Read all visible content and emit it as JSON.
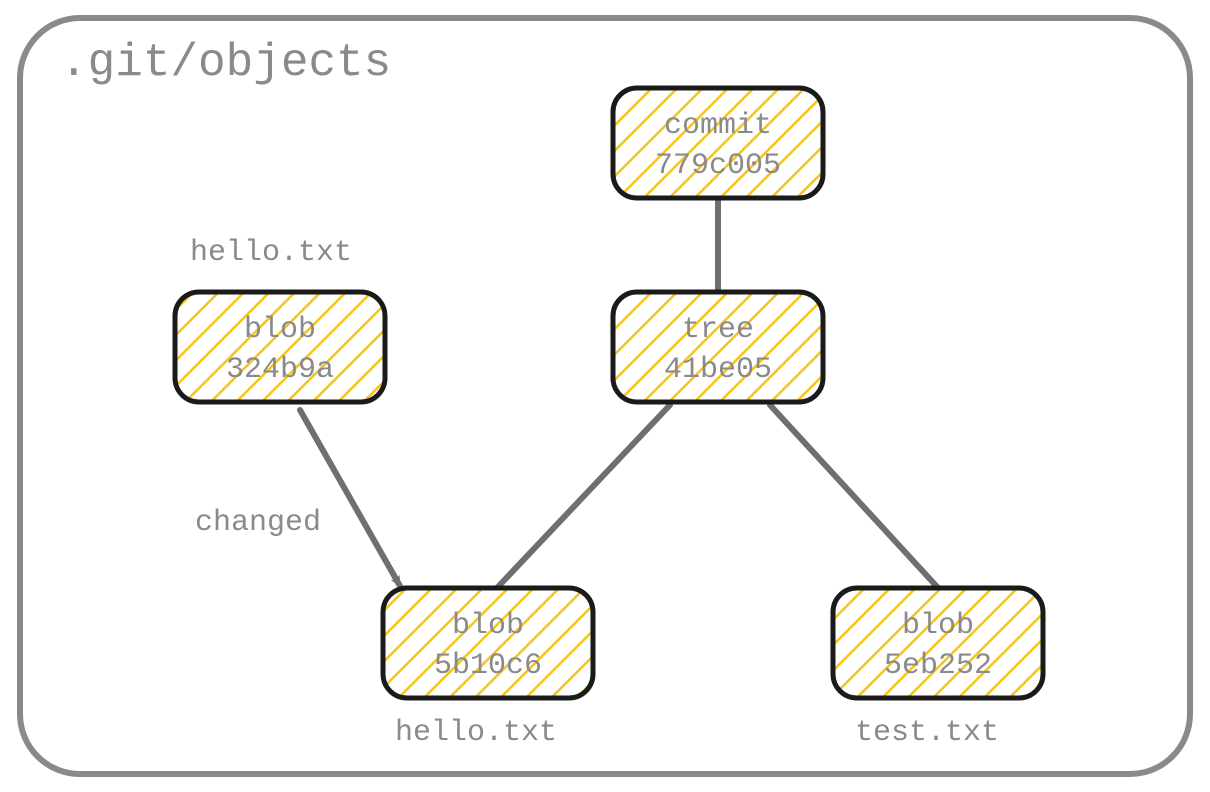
{
  "container": {
    "title": ".git/objects"
  },
  "nodes": {
    "commit": {
      "type": "commit",
      "hash": "779c005"
    },
    "tree": {
      "type": "tree",
      "hash": "41be05"
    },
    "blob_old_hello": {
      "type": "blob",
      "hash": "324b9a"
    },
    "blob_new_hello": {
      "type": "blob",
      "hash": "5b10c6"
    },
    "blob_test": {
      "type": "blob",
      "hash": "5eb252"
    }
  },
  "labels": {
    "old_hello_name": "hello.txt",
    "changed": "changed",
    "new_hello_name": "hello.txt",
    "test_name": "test.txt"
  }
}
